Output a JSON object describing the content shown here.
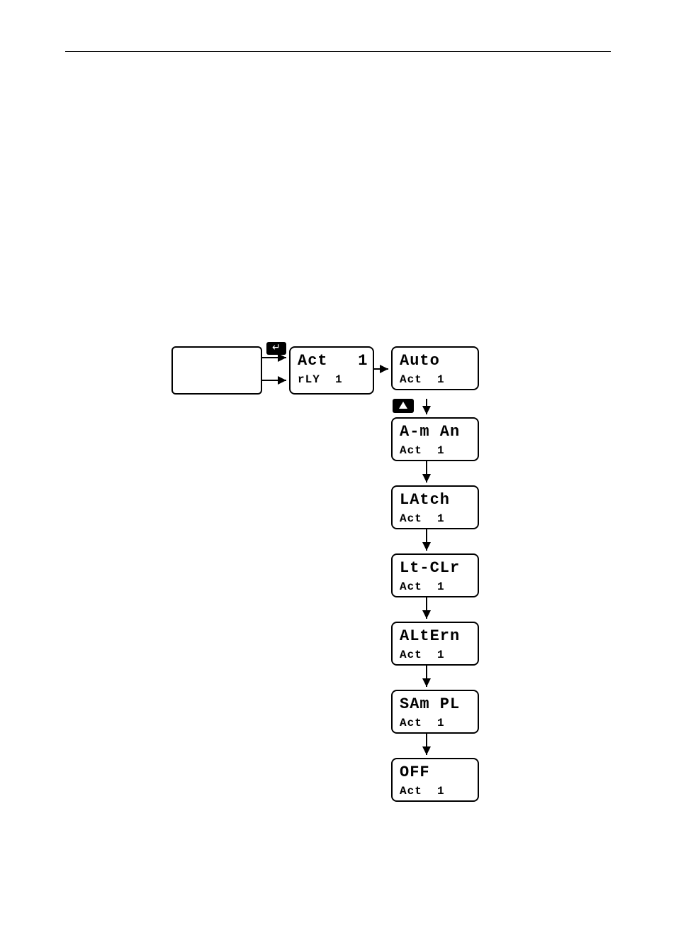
{
  "act_box": {
    "main": "Act   1",
    "sub": "rLY  1"
  },
  "options": [
    {
      "main": "Auto",
      "sub": "Act  1"
    },
    {
      "main": "A-m An",
      "sub": "Act  1"
    },
    {
      "main": "LAtch",
      "sub": "Act  1"
    },
    {
      "main": "Lt-CLr",
      "sub": "Act  1"
    },
    {
      "main": "ALtErn",
      "sub": "Act  1"
    },
    {
      "main": "SAm PL",
      "sub": "Act  1"
    },
    {
      "main": "OFF",
      "sub": "Act  1"
    }
  ],
  "icons": {
    "enter": "enter-icon",
    "up": "up-arrow-icon"
  }
}
